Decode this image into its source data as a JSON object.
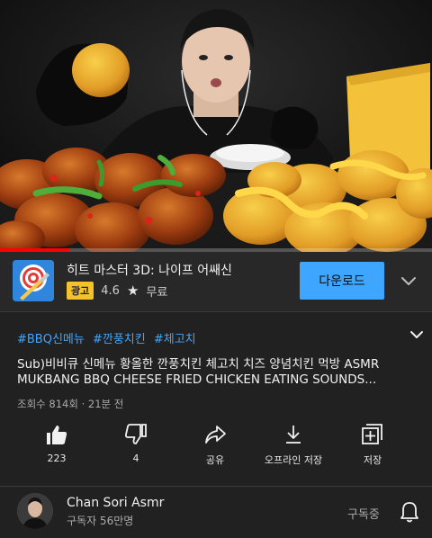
{
  "video": {
    "progress_fraction": 0.16
  },
  "ad": {
    "title": "히트 마스터 3D: 나이프 어쌔신",
    "badge": "광고",
    "rating": "4.6",
    "star_icon": "★",
    "price": "무료",
    "download_label": "다운로드"
  },
  "description": {
    "hashtags": [
      "#BBQ신메뉴",
      "#깐풍치킨",
      "#체고치"
    ],
    "title_line1": "Sub)비비큐 신메뉴 황올한 깐풍치킨 체고치 치즈 양념치킨 먹방 ASMR",
    "title_line2": "MUKBANG BBQ CHEESE FRIED CHICKEN EATING SOUNDS...",
    "stats": "조회수 814회 · 21분 전"
  },
  "actions": {
    "like": "223",
    "dislike": "4",
    "share": "공유",
    "offline": "오프라인 저장",
    "save": "저장"
  },
  "channel": {
    "name": "Chan Sori Asmr",
    "subscribers": "구독자 56만명",
    "subscribed_label": "구독중"
  },
  "colors": {
    "background": "#212121",
    "ad_background": "#282828",
    "accent_blue": "#3ea6ff",
    "ad_badge": "#f6c22b",
    "progress_red": "#ff0000"
  }
}
